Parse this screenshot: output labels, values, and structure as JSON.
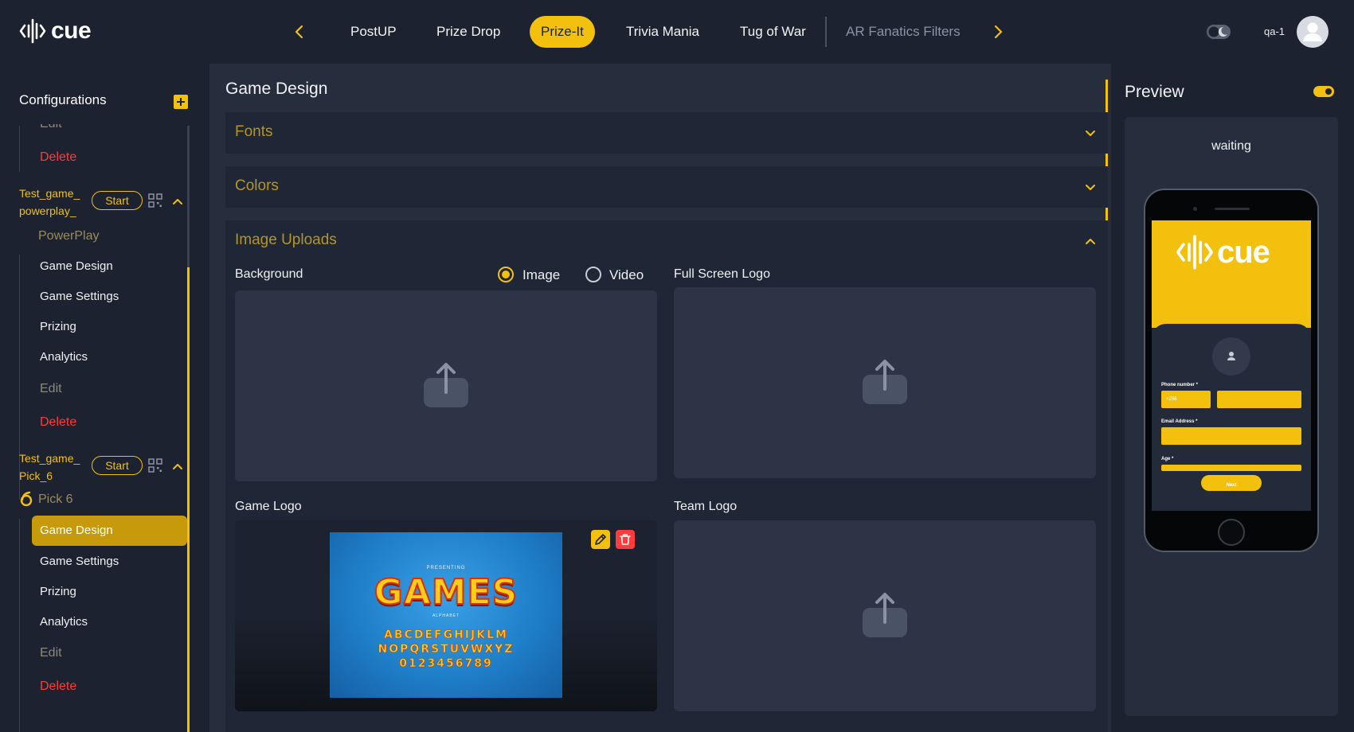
{
  "header": {
    "logo_text": "cue",
    "tabs": [
      {
        "label": "PostUP"
      },
      {
        "label": "Prize Drop"
      },
      {
        "label": "Prize-It"
      },
      {
        "label": "Trivia Mania"
      },
      {
        "label": "Tug of War"
      },
      {
        "label": "AR Fanatics Filters"
      }
    ],
    "active_tab": "Prize-It",
    "username": "qa-1"
  },
  "sidebar": {
    "title": "Configurations",
    "partial_edit": "Edit",
    "delete_top": "Delete",
    "games": [
      {
        "name": "Test_game_\npowerplay_",
        "start_label": "Start",
        "type": "PowerPlay",
        "items": [
          "Game Design",
          "Game Settings",
          "Prizing",
          "Analytics"
        ],
        "edit_label": "Edit",
        "delete_label": "Delete"
      },
      {
        "name": "Test_game_\nPick_6",
        "start_label": "Start",
        "type": "Pick 6",
        "items": [
          "Game Design",
          "Game Settings",
          "Prizing",
          "Analytics"
        ],
        "edit_label": "Edit",
        "delete_label": "Delete",
        "active_item": "Game Design"
      }
    ]
  },
  "main": {
    "title": "Game Design",
    "sections": {
      "fonts": "Fonts",
      "colors": "Colors",
      "image_uploads": "Image Uploads"
    },
    "uploads": {
      "background_label": "Background",
      "radio_image": "Image",
      "radio_video": "Video",
      "background_mode": "Image",
      "full_screen_logo_label": "Full Screen Logo",
      "game_logo_label": "Game Logo",
      "team_logo_label": "Team Logo"
    },
    "game_logo_image": {
      "presenting": "PRESENTING",
      "headline": "GAMES",
      "alphabet": "ALPHABET",
      "row1": "ABCDEFGHIJKLM",
      "row2": "NOPQRSTUVWXYZ",
      "row3": "0123456789"
    }
  },
  "preview": {
    "title": "Preview",
    "status": "waiting",
    "phone": {
      "logo_text": "cue",
      "phone_label": "Phone number *",
      "country_code": "+256",
      "email_label": "Email Address *",
      "age_label": "Age *",
      "next_label": "Next"
    }
  },
  "colors": {
    "accent": "#f3c00e",
    "danger": "#ff3b3b",
    "background": "#1c2230",
    "panel": "#262e3e"
  }
}
